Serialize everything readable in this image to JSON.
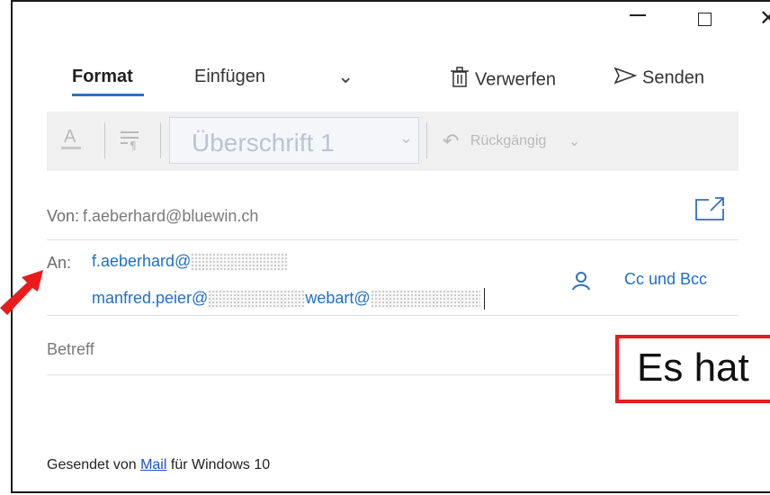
{
  "ribbon": {
    "tab_format": "Format",
    "tab_insert": "Einfügen",
    "discard": "Verwerfen",
    "send": "Senden"
  },
  "toolbar": {
    "style_value": "Überschrift 1",
    "undo": "Rückgängig"
  },
  "from": {
    "label": "Von:",
    "value": "f.aeberhard@bluewin.ch"
  },
  "to": {
    "label": "An:",
    "recipient1": "f.aeberhard@",
    "recipient2": "manfred.peier@",
    "recipient3": "webart@"
  },
  "cc_bcc": "Cc und Bcc",
  "subject": {
    "placeholder": "Betreff"
  },
  "callout_text": "Es hat",
  "signature": {
    "prefix": "Gesendet von ",
    "link": "Mail",
    "suffix": " für Windows 10"
  },
  "colors": {
    "accent": "#2f6fc8",
    "callout_border": "#e81c1c",
    "arrow": "#e81c1c"
  },
  "icons": [
    "minimize-icon",
    "maximize-icon",
    "close-icon",
    "trash-icon",
    "send-icon",
    "font-color-icon",
    "paragraph-icon",
    "undo-icon",
    "popout-icon",
    "person-icon",
    "red-arrow"
  ]
}
